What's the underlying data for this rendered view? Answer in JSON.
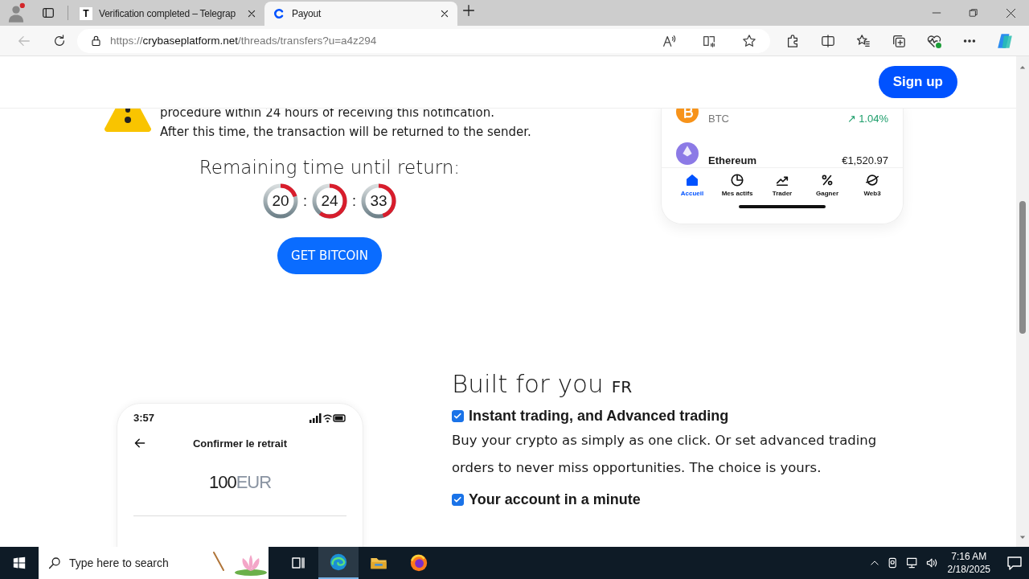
{
  "browser": {
    "tabs": [
      {
        "kind": "telegraph",
        "icon_text": "T",
        "title": "Verification completed – Telegrap",
        "selected": false
      },
      {
        "kind": "coin",
        "title": "Payout",
        "selected": true
      }
    ],
    "url": {
      "scheme": "https://",
      "host": "crybaseplatform.net",
      "path": "/threads/transfers?u=a4z294"
    }
  },
  "header": {
    "sign_up": "Sign up"
  },
  "notice": {
    "lines": [
      "procedure within 24 hours of receiving this notification.",
      "After this time, the transaction will be returned to the sender."
    ]
  },
  "countdown": {
    "title": "Remaining time until return:",
    "timers": [
      {
        "value": "20",
        "level": 0.2
      },
      {
        "value": "24",
        "level": 0.6
      },
      {
        "value": "33",
        "level": 0.45
      }
    ],
    "separators": [
      ":",
      ":"
    ]
  },
  "cta": "GET BITCOIN",
  "app_preview": {
    "coins": [
      {
        "kind": "bitcoin",
        "ticker": "BTC",
        "change": "↗ 1.04%"
      },
      {
        "kind": "ethereum",
        "name": "Ethereum",
        "price": "€1,520.97"
      }
    ],
    "nav": [
      {
        "kind": "home",
        "label": "Accueil",
        "selected": true
      },
      {
        "kind": "pie",
        "label": "Mes actifs",
        "selected": false
      },
      {
        "kind": "trend",
        "label": "Trader",
        "selected": false
      },
      {
        "kind": "percent",
        "label": "Gagner",
        "selected": false
      },
      {
        "kind": "planet",
        "label": "Web3",
        "selected": false
      }
    ]
  },
  "features": {
    "title": "Built for you",
    "badge": "FR",
    "items": [
      {
        "title": "Instant trading, and Advanced trading",
        "checked": true,
        "body": "Buy your crypto as simply as one click. Or set advanced trading orders to never miss opportunities. The choice is yours."
      },
      {
        "title": "Your account in a minute",
        "checked": true
      }
    ]
  },
  "withdraw_preview": {
    "time": "3:57",
    "title": "Confirmer le retrait",
    "amount": "100",
    "currency": "EUR"
  },
  "taskbar": {
    "search_placeholder": "Type here to search",
    "apps": [
      {
        "kind": "taskview",
        "selected": false
      },
      {
        "kind": "edge",
        "selected": true
      },
      {
        "kind": "explorer",
        "selected": false
      },
      {
        "kind": "firefox",
        "selected": false
      }
    ],
    "time": "7:16 AM",
    "date": "2/18/2025"
  }
}
